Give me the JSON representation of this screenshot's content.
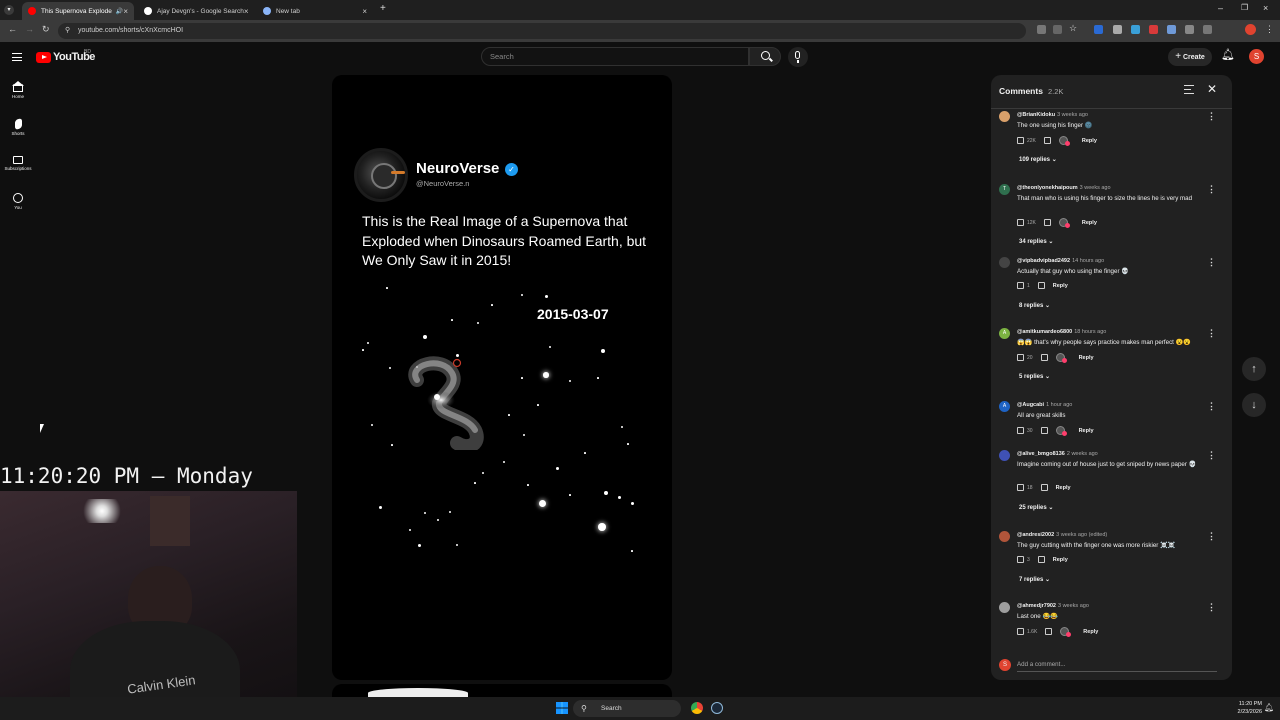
{
  "browser": {
    "tabs": [
      {
        "title": "This Supernova Exploded D",
        "active": true
      },
      {
        "title": "Ajay Devgn's - Google Search",
        "active": false
      },
      {
        "title": "New tab",
        "active": false
      }
    ],
    "url": "youtube.com/shorts/cXnXcmcHOI"
  },
  "header": {
    "logo_text": "YouTube",
    "country_code": "BD",
    "search_placeholder": "Search",
    "create_label": "Create",
    "avatar_initial": "S"
  },
  "guide": [
    {
      "label": "Home",
      "icon": "home-icon"
    },
    {
      "label": "Shorts",
      "icon": "shorts-icon"
    },
    {
      "label": "Subscriptions",
      "icon": "subscriptions-icon"
    },
    {
      "label": "You",
      "icon": "you-icon"
    }
  ],
  "short": {
    "channel_name": "NeuroVerse",
    "handle": "@NeuroVerse.n",
    "headline": "This is the Real Image of a Supernova that Exploded when Dinosaurs Roamed Earth, but We Only Saw it in 2015!",
    "date_stamp": "2015-03-07"
  },
  "comments": {
    "title": "Comments",
    "count": "2.2K",
    "add_placeholder": "Add a comment...",
    "user_initial": "S",
    "reply_label": "Reply",
    "items": [
      {
        "author": "@BrianKidoku",
        "time": "3 weeks ago",
        "text": "The one using his finger 🌚",
        "likes": "22K",
        "creator_heart": true,
        "replies": "109 replies",
        "avatar_color": "#d9a06a",
        "initial": ""
      },
      {
        "author": "@theonlyonekhaipoum",
        "time": "3 weeks ago",
        "text": "That man who is using his finger to size the lines he is very mad",
        "likes": "12K",
        "creator_heart": true,
        "replies": "34 replies",
        "avatar_color": "#2f6f4e",
        "initial": "T"
      },
      {
        "author": "@vipbadvipbad2492",
        "time": "14 hours ago",
        "text": "Actually that guy who using the finger 💀",
        "likes": "1",
        "creator_heart": false,
        "replies": "8 replies",
        "avatar_color": "#444444",
        "initial": ""
      },
      {
        "author": "@amitkumardeo6800",
        "time": "18 hours ago",
        "text": "😱😱 that's why people says practice makes man perfect 😮😮",
        "likes": "20",
        "creator_heart": true,
        "replies": "5 replies",
        "avatar_color": "#7cb342",
        "initial": "A"
      },
      {
        "author": "@Augcabi",
        "time": "1 hour ago",
        "text": "All are great skills",
        "likes": "30",
        "creator_heart": true,
        "replies": "",
        "avatar_color": "#1e63c4",
        "initial": "A"
      },
      {
        "author": "@alive_bmgo8136",
        "time": "2 weeks ago",
        "text": "Imagine coming out of house just to get sniped by news paper 💀",
        "likes": "18",
        "creator_heart": false,
        "replies": "25 replies",
        "avatar_color": "#3f51b5",
        "initial": ""
      },
      {
        "author": "@andresi2002",
        "time": "3 weeks ago (edited)",
        "text": "The guy cutting with the finger one was more riskier ☠️☠️",
        "likes": "3",
        "creator_heart": false,
        "replies": "7 replies",
        "avatar_color": "#b0553a",
        "initial": ""
      },
      {
        "author": "@ahmedjr7902",
        "time": "3 weeks ago",
        "text": "Last one 😂😂",
        "likes": "1.6K",
        "creator_heart": true,
        "replies": "",
        "avatar_color": "#9e9e9e",
        "initial": ""
      }
    ]
  },
  "overlay": {
    "clock_text": "11:20:20 PM – Monday",
    "webcam_shirt_text": "Calvin Klein"
  },
  "taskbar": {
    "search_label": "Search",
    "time": "11:20 PM",
    "date": "2/23/2026"
  }
}
